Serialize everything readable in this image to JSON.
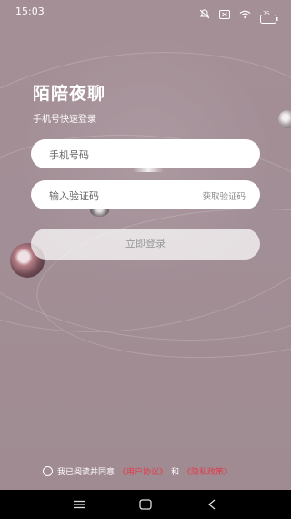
{
  "status_bar": {
    "time": "15:03",
    "icons": [
      "bell-off-icon",
      "sim-card-icon",
      "wifi-icon",
      "battery-icon"
    ],
    "battery_level": "75"
  },
  "app": {
    "title": "陌陪夜聊",
    "subtitle": "手机号快速登录"
  },
  "form": {
    "phone_placeholder": "手机号码",
    "code_placeholder": "输入验证码",
    "get_code_label": "获取验证码",
    "login_label": "立即登录"
  },
  "agreement": {
    "prefix": "我已阅读并同意",
    "user_agreement": "《用户协议》",
    "conjunction": "和",
    "privacy_policy": "《隐私政策》",
    "link_color": "#e33b4a"
  },
  "nav_bar": {
    "buttons": [
      "menu-icon",
      "home-icon",
      "back-icon"
    ]
  }
}
